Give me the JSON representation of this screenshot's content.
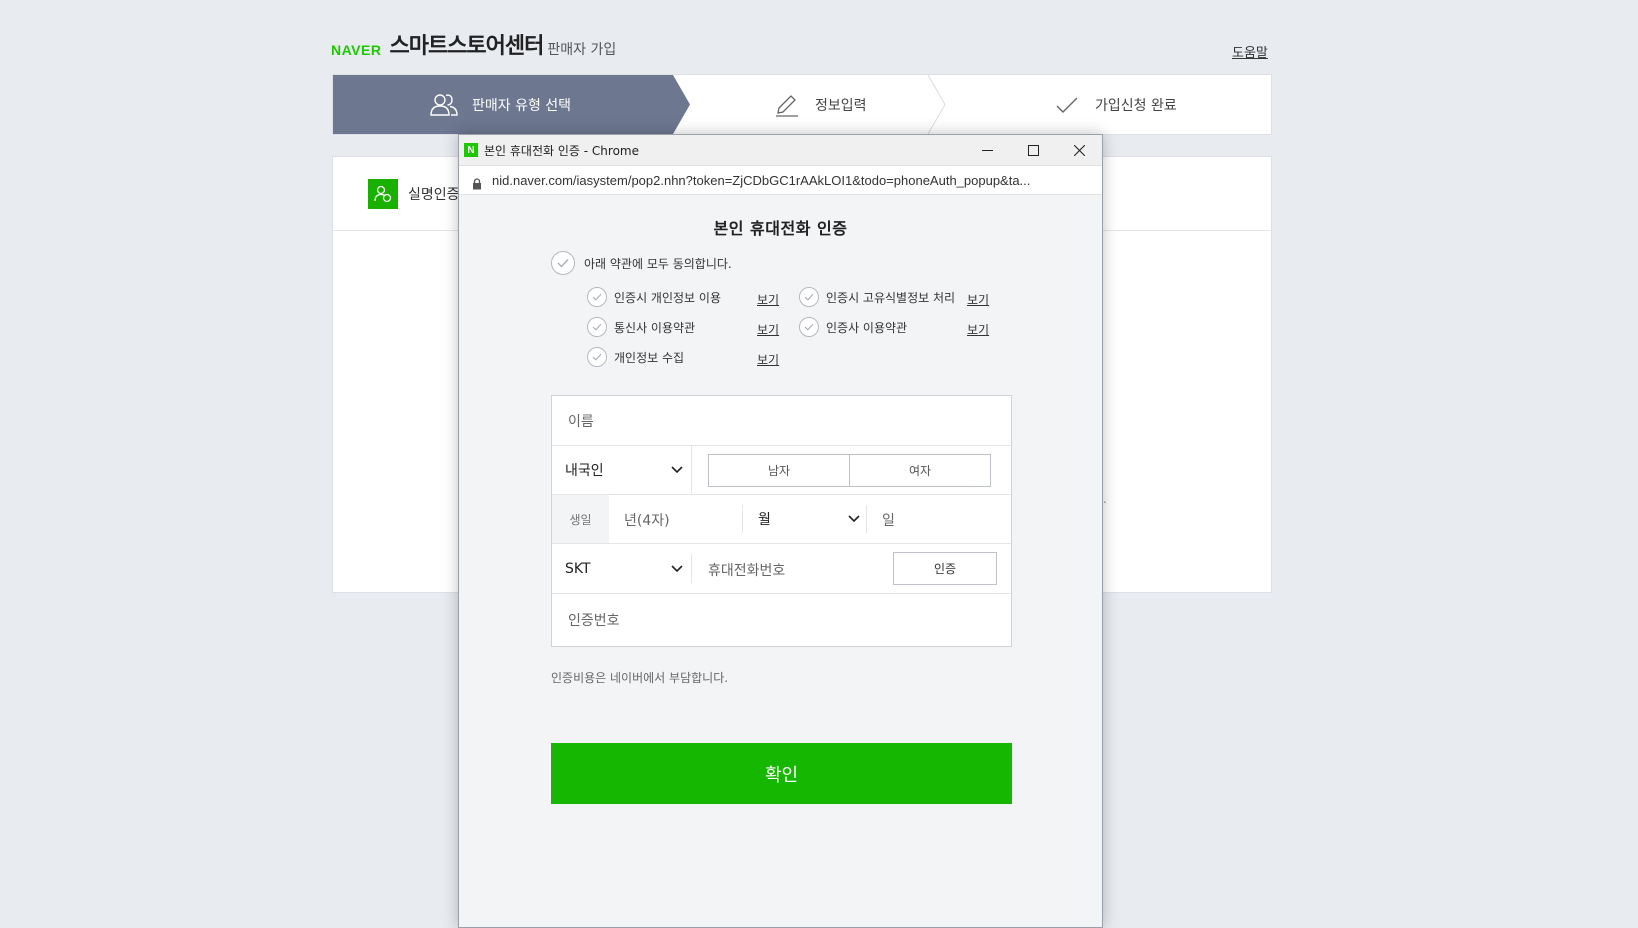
{
  "header": {
    "logo": "NAVER",
    "brand": "스마트스토어센터",
    "sub": "판매자 가입",
    "help": "도움말"
  },
  "steps": [
    {
      "label": "판매자 유형 선택",
      "icon": "users-icon",
      "active": true
    },
    {
      "label": "정보입력",
      "icon": "pencil-icon",
      "active": false
    },
    {
      "label": "가입신청 완료",
      "icon": "check-icon",
      "active": false
    }
  ],
  "card": {
    "label": "실명인증",
    "dot": "."
  },
  "popup": {
    "window_title": "본인 휴대전화 인증 - Chrome",
    "url": "nid.naver.com/iasystem/pop2.nhn?token=ZjCDbGC1rAAkLOI1&todo=phoneAuth_popup&ta...",
    "title": "본인 휴대전화 인증",
    "agree_all": "아래 약관에 모두 동의합니다.",
    "terms": [
      {
        "label": "인증시 개인정보 이용",
        "view": "보기"
      },
      {
        "label": "인증시 고유식별정보 처리",
        "view": "보기"
      },
      {
        "label": "통신사 이용약관",
        "view": "보기"
      },
      {
        "label": "인증사 이용약관",
        "view": "보기"
      },
      {
        "label": "개인정보 수집",
        "view": "보기"
      }
    ],
    "form": {
      "name_placeholder": "이름",
      "nationality": "내국인",
      "gender_male": "남자",
      "gender_female": "여자",
      "birth_label": "생일",
      "year_placeholder": "년(4자)",
      "month": "월",
      "day_placeholder": "일",
      "carrier": "SKT",
      "phone_placeholder": "휴대전화번호",
      "auth_button": "인증",
      "code_placeholder": "인증번호"
    },
    "note": "인증비용은 네이버에서 부담합니다.",
    "confirm": "확인"
  },
  "colors": {
    "naver_green": "#1ec800",
    "confirm_green": "#15b700",
    "active_step": "#6d7790"
  }
}
